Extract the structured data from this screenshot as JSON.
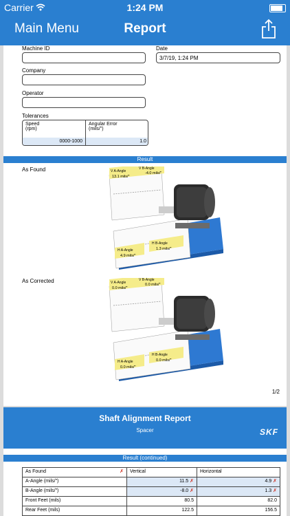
{
  "status": {
    "carrier": "Carrier",
    "time": "1:24 PM"
  },
  "nav": {
    "back_label": "Main Menu",
    "title": "Report"
  },
  "form": {
    "machine_id_label": "Machine ID",
    "date_label": "Date",
    "date_value": "3/7/19, 1:24 PM",
    "company_label": "Company",
    "operator_label": "Operator",
    "tolerances_label": "Tolerances",
    "speed_header_1": "Speed",
    "speed_header_2": "(rpm)",
    "angular_header_1": "Angular Error",
    "angular_header_2": "(mils/\")",
    "speed_value": "0000-1000",
    "angular_value": "1.0"
  },
  "result": {
    "bar_label": "Result",
    "as_found_label": "As Found",
    "as_corrected_label": "As Corrected",
    "found": {
      "v_label": "V A-Angle",
      "v_value": "13.1 mils/\"",
      "v2_label": "V B-Angle",
      "v2_value": "-4.0 mils/\"",
      "h_label": "H A-Angle",
      "h_value": "4.9 mils/\"",
      "h2_label": "H B-Angle",
      "h2_value": "1.3 mils/\""
    },
    "corrected": {
      "v_label": "V A-Angle",
      "v_value": "0.0 mils/\"",
      "v2_label": "V B-Angle",
      "v2_value": "0.0 mils/\"",
      "h_label": "H A-Angle",
      "h_value": "0.0 mils/\"",
      "h2_label": "H B-Angle",
      "h2_value": "0.0 mils/\""
    },
    "page_number": "1/2"
  },
  "page2": {
    "title": "Shaft Alignment Report",
    "subtitle": "Spacer",
    "logo": "SKF",
    "bar_label": "Result (continued)",
    "table": {
      "header": [
        "As Found",
        "Vertical",
        "Horizontal"
      ],
      "rows": [
        {
          "label": "A-Angle (mils/\")",
          "vertical": "11.5",
          "horizontal": "4.9"
        },
        {
          "label": "B-Angle (mils/\")",
          "vertical": "-8.0",
          "horizontal": "1.3"
        },
        {
          "label": "Front Feet (mils)",
          "vertical": "80.5",
          "horizontal": "82.0"
        },
        {
          "label": "Rear Feet (mils)",
          "vertical": "122.5",
          "horizontal": "156.5"
        }
      ]
    }
  },
  "colors": {
    "accent": "#2a7fd0",
    "shade": "#dce8f6",
    "warning": "#d03020"
  }
}
